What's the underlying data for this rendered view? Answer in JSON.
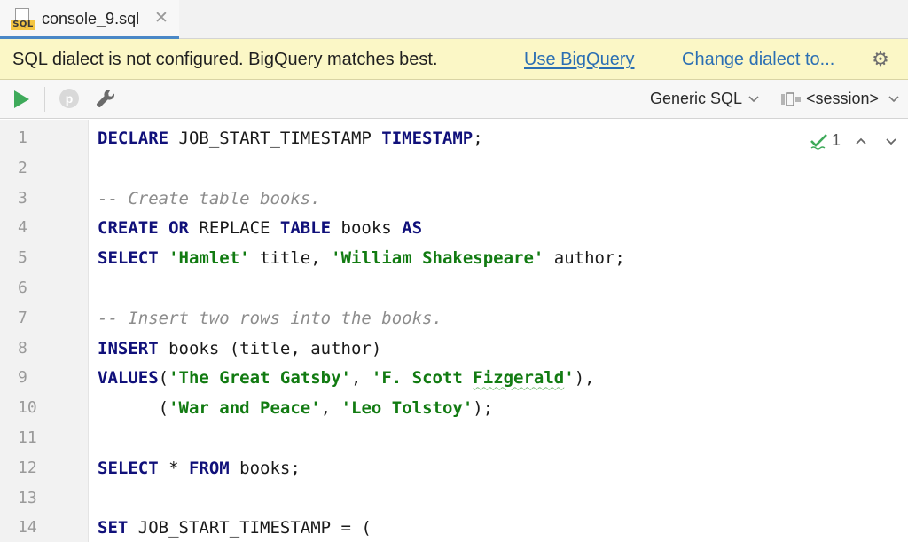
{
  "tab": {
    "icon": "sql-file-icon",
    "icon_label": "SQL",
    "title": "console_9.sql",
    "close_glyph": "✕"
  },
  "banner": {
    "message": "SQL dialect is not configured. BigQuery matches best.",
    "use_link": "Use BigQuery",
    "change_link": "Change dialect to...",
    "bg_color": "#fbf7c6"
  },
  "toolbar": {
    "p_label": "p",
    "dialect": "Generic SQL",
    "session": "<session>"
  },
  "inspection": {
    "count": "1"
  },
  "editor": {
    "line_numbers": [
      "1",
      "2",
      "3",
      "4",
      "5",
      "6",
      "7",
      "8",
      "9",
      "10",
      "11",
      "12",
      "13",
      "14"
    ],
    "lines": [
      [
        {
          "t": "kw",
          "v": "DECLARE"
        },
        {
          "t": "id",
          "v": " JOB_START_TIMESTAMP "
        },
        {
          "t": "kw",
          "v": "TIMESTAMP"
        },
        {
          "t": "id",
          "v": ";"
        }
      ],
      [],
      [
        {
          "t": "cmt",
          "v": "-- Create table books."
        }
      ],
      [
        {
          "t": "kw",
          "v": "CREATE OR"
        },
        {
          "t": "id",
          "v": " REPLACE "
        },
        {
          "t": "kw",
          "v": "TABLE"
        },
        {
          "t": "id",
          "v": " books "
        },
        {
          "t": "kw",
          "v": "AS"
        }
      ],
      [
        {
          "t": "kw",
          "v": "SELECT"
        },
        {
          "t": "id",
          "v": " "
        },
        {
          "t": "str",
          "v": "'Hamlet'"
        },
        {
          "t": "id",
          "v": " title, "
        },
        {
          "t": "str",
          "v": "'William Shakespeare'"
        },
        {
          "t": "id",
          "v": " author;"
        }
      ],
      [],
      [
        {
          "t": "cmt",
          "v": "-- Insert two rows into the books."
        }
      ],
      [
        {
          "t": "kw",
          "v": "INSERT"
        },
        {
          "t": "id",
          "v": " books (title, author)"
        }
      ],
      [
        {
          "t": "kw",
          "v": "VALUES"
        },
        {
          "t": "id",
          "v": "("
        },
        {
          "t": "str",
          "v": "'The Great Gatsby'"
        },
        {
          "t": "id",
          "v": ", "
        },
        {
          "t": "str",
          "v": "'F. Scott "
        },
        {
          "t": "typo",
          "v": "Fizgerald"
        },
        {
          "t": "str",
          "v": "'"
        },
        {
          "t": "id",
          "v": "),"
        }
      ],
      [
        {
          "t": "id",
          "v": "      ("
        },
        {
          "t": "str",
          "v": "'War and Peace'"
        },
        {
          "t": "id",
          "v": ", "
        },
        {
          "t": "str",
          "v": "'Leo Tolstoy'"
        },
        {
          "t": "id",
          "v": ");"
        }
      ],
      [],
      [
        {
          "t": "kw",
          "v": "SELECT"
        },
        {
          "t": "id",
          "v": " * "
        },
        {
          "t": "kw",
          "v": "FROM"
        },
        {
          "t": "id",
          "v": " books;"
        }
      ],
      [],
      [
        {
          "t": "kw",
          "v": "SET"
        },
        {
          "t": "id",
          "v": " JOB_START_TIMESTAMP = ("
        }
      ]
    ]
  },
  "icons": {
    "run": "run-icon",
    "wrench": "wrench-icon",
    "gear": "gear-icon",
    "session": "session-icon",
    "check": "inspection-check-icon"
  },
  "colors": {
    "keyword": "#10107a",
    "string": "#127b12",
    "comment": "#8c8c8c",
    "run": "#3eaa5a",
    "link": "#2b6fb3",
    "tab_accent": "#4a88c7"
  }
}
